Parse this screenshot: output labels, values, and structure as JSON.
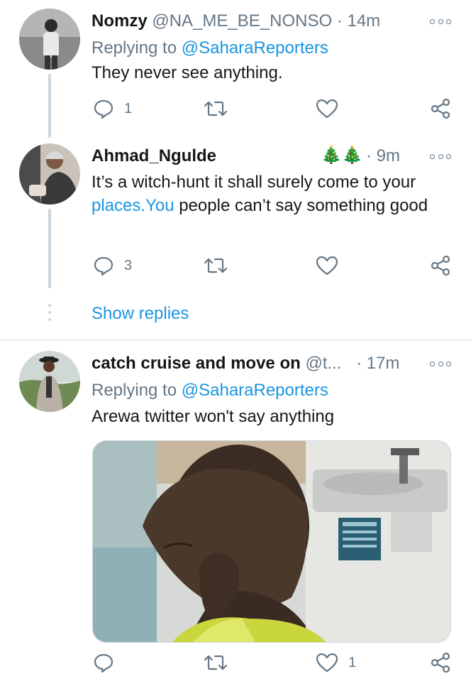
{
  "tweets": [
    {
      "display_name": "Nomzy",
      "handle": "@NA_ME_BE_NONSO",
      "separator": "·",
      "time": "14m",
      "replying_prefix": "Replying to",
      "replying_to": "@SaharaReporters",
      "text": "They never see anything.",
      "reply_count": "1"
    },
    {
      "display_name": "Ahmad_Ngulde",
      "name_emojis": "🎄🎄",
      "separator": "·",
      "time": "9m",
      "text_part1": "It’s a witch-hunt it shall surely come to your",
      "text_link": "places.You",
      "text_part2": "people can’t say something good",
      "reply_count": "3"
    },
    {
      "display_name": "catch cruise and move on",
      "handle": "@t...",
      "separator": "·",
      "time": "17m",
      "replying_prefix": "Replying to",
      "replying_to": "@SaharaReporters",
      "text": "Arewa twitter won't say anything",
      "like_count": "1"
    }
  ],
  "show_replies_label": "Show replies",
  "colors": {
    "link": "#1b95e0",
    "secondary_text": "#657786",
    "primary_text": "#14171a",
    "thread_line": "#ccd6dd"
  },
  "icons": [
    "reply-icon",
    "retweet-icon",
    "like-icon",
    "share-icon",
    "more-icon"
  ]
}
